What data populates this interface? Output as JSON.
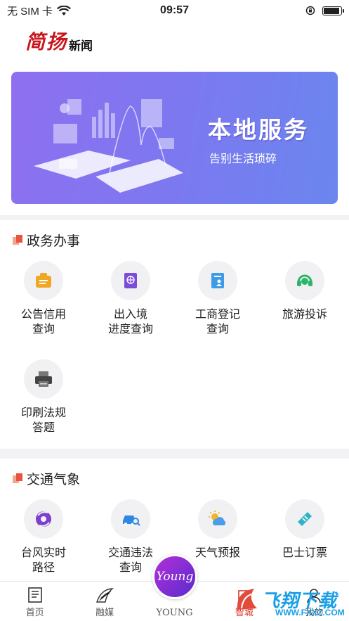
{
  "status_bar": {
    "carrier": "无 SIM 卡",
    "time": "09:57",
    "battery_level": 0.9
  },
  "header": {
    "logo_main": "简扬",
    "logo_sub": "新闻"
  },
  "banner": {
    "title": "本地服务",
    "subtitle": "告别生活琐碎"
  },
  "government": {
    "title": "政务办事",
    "items": [
      {
        "label": "公告信用\n查询",
        "icon": "notice-icon"
      },
      {
        "label": "出入境\n进度查询",
        "icon": "passport-icon"
      },
      {
        "label": "工商登记\n查询",
        "icon": "registration-icon"
      },
      {
        "label": "旅游投诉",
        "icon": "headset-icon"
      },
      {
        "label": "印刷法规\n答题",
        "icon": "printer-icon"
      }
    ]
  },
  "traffic": {
    "title": "交通气象",
    "items": [
      {
        "label": "台风实时\n路径",
        "icon": "typhoon-icon"
      },
      {
        "label": "交通违法\n查询",
        "icon": "car-search-icon"
      },
      {
        "label": "天气预报",
        "icon": "weather-icon"
      },
      {
        "label": "巴士订票",
        "icon": "ticket-icon"
      }
    ]
  },
  "tabbar": {
    "tabs": [
      {
        "label": "首页",
        "icon": "newspaper-icon"
      },
      {
        "label": "融媒",
        "icon": "media-icon"
      },
      {
        "label": "YOUNG",
        "icon": "young-logo"
      },
      {
        "label": "智城",
        "icon": "city-icon"
      },
      {
        "label": "我的",
        "icon": "profile-icon"
      }
    ],
    "young_badge": "Young"
  },
  "watermark": {
    "text": "飞翔下载",
    "url": "WWW.FXXZ.COM"
  },
  "colors": {
    "accent_red": "#c8161d",
    "banner_start": "#8e6ff0",
    "banner_end": "#6a86ee",
    "watermark": "#1a9fe6"
  }
}
